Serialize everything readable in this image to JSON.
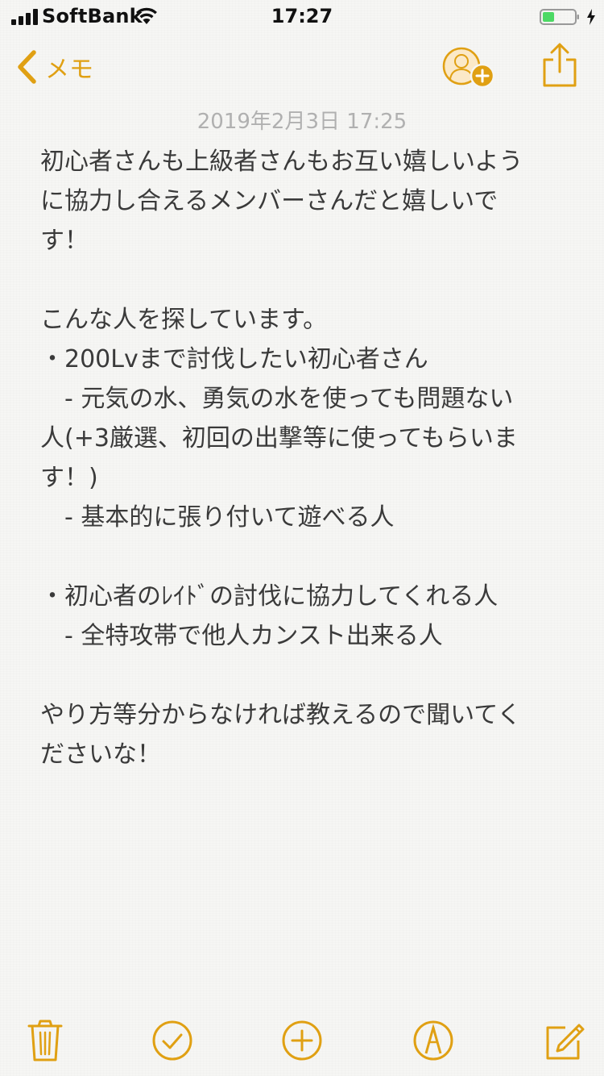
{
  "status_bar": {
    "carrier": "SoftBank",
    "time": "17:27"
  },
  "nav": {
    "back_label": "メモ",
    "icons": [
      "chevron-left-icon",
      "add-person-icon",
      "share-icon"
    ]
  },
  "note": {
    "date": "2019年2月3日 17:25",
    "lines": [
      "初心者さんも上級者さんもお互い嬉しいよう",
      "に協力し合えるメンバーさんだと嬉しいで",
      "す！",
      "",
      "こんな人を探しています。",
      "・200Lvまで討伐したい初心者さん",
      "- 元気の水、勇気の水を使っても問題ない",
      "人(+3厳選、初回の出撃等に使ってもらいま",
      "す！)",
      "- 基本的に張り付いて遊べる人",
      "",
      "・初心者のﾚｲﾄﾞの討伐に協力してくれる人",
      "- 全特攻帯で他人カンスト出来る人",
      "",
      "やり方等分からなければ教えるので聞いてく",
      "ださいな！"
    ]
  },
  "toolbar": {
    "icons": [
      "trash-icon",
      "checklist-icon",
      "add-icon",
      "markup-icon",
      "compose-icon"
    ]
  },
  "colors": {
    "accent": "#e0a013",
    "text": "#3a3a3a",
    "date": "#b0b0b0",
    "background": "#f6f6f4",
    "battery_fill": "#4cd964"
  }
}
